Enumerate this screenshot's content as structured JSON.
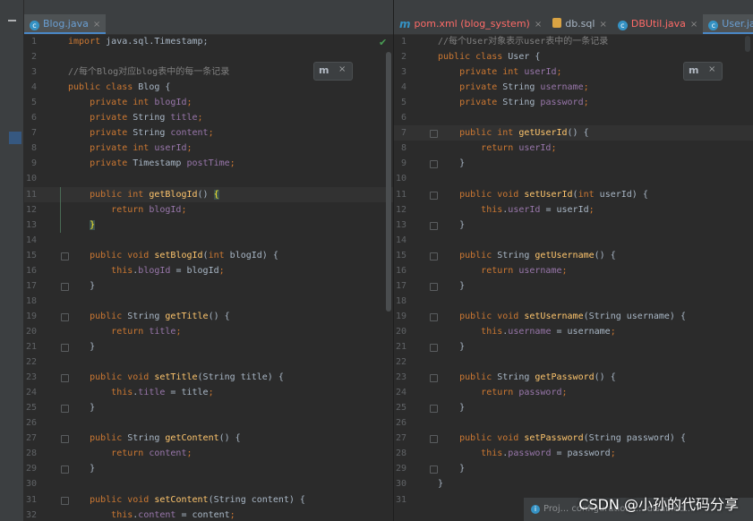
{
  "left_pane": {
    "tabs": [
      {
        "label": "Blog.java",
        "icon": "java-class-icon",
        "style": "blue",
        "active": true
      }
    ],
    "current_line": 11,
    "lines": [
      [
        [
          "java.sql.Timestamp;",
          "p"
        ]
      ],
      [],
      [
        [
          "//每个Blog对应blog表中的每一条记录",
          "cm"
        ]
      ],
      [],
      [
        [
          "    ",
          "p"
        ],
        [
          "private ",
          "kw"
        ],
        [
          "int ",
          "kw"
        ],
        [
          "blogId",
          "fld"
        ],
        [
          ";",
          "kw"
        ]
      ],
      [
        [
          "    ",
          "p"
        ],
        [
          "private ",
          "kw"
        ],
        [
          "String ",
          "p"
        ],
        [
          "title",
          "fld"
        ],
        [
          ";",
          "kw"
        ]
      ],
      [
        [
          "    ",
          "p"
        ],
        [
          "private ",
          "kw"
        ],
        [
          "String ",
          "p"
        ],
        [
          "content",
          "fld"
        ],
        [
          ";",
          "kw"
        ]
      ],
      [
        [
          "    ",
          "p"
        ],
        [
          "private ",
          "kw"
        ],
        [
          "int ",
          "kw"
        ],
        [
          "userId",
          "fld"
        ],
        [
          ";",
          "kw"
        ]
      ],
      [
        [
          "    ",
          "p"
        ],
        [
          "private ",
          "kw"
        ],
        [
          "Timestamp ",
          "p"
        ],
        [
          "postTime",
          "fld"
        ],
        [
          ";",
          "kw"
        ]
      ],
      [],
      [
        [
          "    ",
          "p"
        ],
        [
          "public ",
          "kw"
        ],
        [
          "int ",
          "kw"
        ],
        [
          "getBlogId",
          "fn"
        ],
        [
          "() ",
          "p"
        ],
        [
          "{",
          "brk"
        ]
      ],
      [
        [
          "        ",
          "p"
        ],
        [
          "return ",
          "kw"
        ],
        [
          "blogId",
          "fld"
        ],
        [
          ";",
          "kw"
        ]
      ],
      [
        [
          "    ",
          "p"
        ],
        [
          "}",
          "brk"
        ]
      ],
      [],
      [
        [
          "    ",
          "p"
        ],
        [
          "public ",
          "kw"
        ],
        [
          "void ",
          "kw"
        ],
        [
          "setBlogId",
          "fn"
        ],
        [
          "(",
          "p"
        ],
        [
          "int ",
          "kw"
        ],
        [
          "blogId) {",
          "p"
        ]
      ],
      [
        [
          "        ",
          "p"
        ],
        [
          "this",
          "kw"
        ],
        [
          ".",
          "p"
        ],
        [
          "blogId",
          "fld"
        ],
        [
          " = blogId",
          "p"
        ],
        [
          ";",
          "kw"
        ]
      ],
      [
        [
          "    }",
          "p"
        ]
      ],
      [],
      [
        [
          "    ",
          "p"
        ],
        [
          "public ",
          "kw"
        ],
        [
          "String ",
          "p"
        ],
        [
          "getTitle",
          "fn"
        ],
        [
          "() {",
          "p"
        ]
      ],
      [
        [
          "        ",
          "p"
        ],
        [
          "return ",
          "kw"
        ],
        [
          "title",
          "fld"
        ],
        [
          ";",
          "kw"
        ]
      ],
      [
        [
          "    }",
          "p"
        ]
      ],
      [],
      [
        [
          "    ",
          "p"
        ],
        [
          "public ",
          "kw"
        ],
        [
          "void ",
          "kw"
        ],
        [
          "setTitle",
          "fn"
        ],
        [
          "(String title) {",
          "p"
        ]
      ],
      [
        [
          "        ",
          "p"
        ],
        [
          "this",
          "kw"
        ],
        [
          ".",
          "p"
        ],
        [
          "title",
          "fld"
        ],
        [
          " = title",
          "p"
        ],
        [
          ";",
          "kw"
        ]
      ],
      [
        [
          "    }",
          "p"
        ]
      ],
      [],
      [
        [
          "    ",
          "p"
        ],
        [
          "public ",
          "kw"
        ],
        [
          "String ",
          "p"
        ],
        [
          "getContent",
          "fn"
        ],
        [
          "() {",
          "p"
        ]
      ],
      [
        [
          "        ",
          "p"
        ],
        [
          "return ",
          "kw"
        ],
        [
          "content",
          "fld"
        ],
        [
          ";",
          "kw"
        ]
      ],
      [
        [
          "    }",
          "p"
        ]
      ],
      [],
      [
        [
          "    ",
          "p"
        ],
        [
          "public ",
          "kw"
        ],
        [
          "void ",
          "kw"
        ],
        [
          "setContent",
          "fn"
        ],
        [
          "(String content) {",
          "p"
        ]
      ],
      [
        [
          "        ",
          "p"
        ],
        [
          "this",
          "kw"
        ],
        [
          ".",
          "p"
        ],
        [
          "content",
          "fld"
        ],
        [
          " = content",
          "p"
        ],
        [
          ";",
          "kw"
        ]
      ]
    ],
    "first_line_prefix": "import ",
    "line4_prefix": "public class Blog {",
    "bubble_close": "×"
  },
  "right_pane": {
    "tabs": [
      {
        "label": "pom.xml (blog_system)",
        "icon": "maven-icon",
        "style": "red",
        "active": false
      },
      {
        "label": "db.sql",
        "icon": "sql-file-icon",
        "style": "plain",
        "active": false
      },
      {
        "label": "DBUtil.java",
        "icon": "java-class-icon",
        "style": "red",
        "active": false
      },
      {
        "label": "User.java",
        "icon": "java-class-icon",
        "style": "blue",
        "active": true
      }
    ],
    "current_line": 7,
    "lines": [
      [
        [
          "//每个User对象表示user表中的一条记录",
          "cm"
        ]
      ],
      [
        [
          "public ",
          "kw"
        ],
        [
          "class ",
          "kw"
        ],
        [
          "User {",
          "p"
        ]
      ],
      [
        [
          "    ",
          "p"
        ],
        [
          "private ",
          "kw"
        ],
        [
          "int ",
          "kw"
        ],
        [
          "userId",
          "fld"
        ],
        [
          ";",
          "kw"
        ]
      ],
      [
        [
          "    ",
          "p"
        ],
        [
          "private ",
          "kw"
        ],
        [
          "String ",
          "p"
        ],
        [
          "username",
          "fld"
        ],
        [
          ";",
          "kw"
        ]
      ],
      [
        [
          "    ",
          "p"
        ],
        [
          "private ",
          "kw"
        ],
        [
          "String ",
          "p"
        ],
        [
          "password",
          "fld"
        ],
        [
          ";",
          "kw"
        ]
      ],
      [],
      [
        [
          "    ",
          "p"
        ],
        [
          "public ",
          "kw"
        ],
        [
          "int ",
          "kw"
        ],
        [
          "getUserId",
          "fn"
        ],
        [
          "() {",
          "p"
        ]
      ],
      [
        [
          "        ",
          "p"
        ],
        [
          "return ",
          "kw"
        ],
        [
          "userId",
          "fld"
        ],
        [
          ";",
          "kw"
        ]
      ],
      [
        [
          "    }",
          "p"
        ]
      ],
      [],
      [
        [
          "    ",
          "p"
        ],
        [
          "public ",
          "kw"
        ],
        [
          "void ",
          "kw"
        ],
        [
          "setUserId",
          "fn"
        ],
        [
          "(",
          "p"
        ],
        [
          "int ",
          "kw"
        ],
        [
          "userId) {",
          "p"
        ]
      ],
      [
        [
          "        ",
          "p"
        ],
        [
          "this",
          "kw"
        ],
        [
          ".",
          "p"
        ],
        [
          "userId",
          "fld"
        ],
        [
          " = userId",
          "p"
        ],
        [
          ";",
          "kw"
        ]
      ],
      [
        [
          "    }",
          "p"
        ]
      ],
      [],
      [
        [
          "    ",
          "p"
        ],
        [
          "public ",
          "kw"
        ],
        [
          "String ",
          "p"
        ],
        [
          "getUsername",
          "fn"
        ],
        [
          "() {",
          "p"
        ]
      ],
      [
        [
          "        ",
          "p"
        ],
        [
          "return ",
          "kw"
        ],
        [
          "username",
          "fld"
        ],
        [
          ";",
          "kw"
        ]
      ],
      [
        [
          "    }",
          "p"
        ]
      ],
      [],
      [
        [
          "    ",
          "p"
        ],
        [
          "public ",
          "kw"
        ],
        [
          "void ",
          "kw"
        ],
        [
          "setUsername",
          "fn"
        ],
        [
          "(String username) {",
          "p"
        ]
      ],
      [
        [
          "        ",
          "p"
        ],
        [
          "this",
          "kw"
        ],
        [
          ".",
          "p"
        ],
        [
          "username",
          "fld"
        ],
        [
          " = username",
          "p"
        ],
        [
          ";",
          "kw"
        ]
      ],
      [
        [
          "    }",
          "p"
        ]
      ],
      [],
      [
        [
          "    ",
          "p"
        ],
        [
          "public ",
          "kw"
        ],
        [
          "String ",
          "p"
        ],
        [
          "getPassword",
          "fn"
        ],
        [
          "() {",
          "p"
        ]
      ],
      [
        [
          "        ",
          "p"
        ],
        [
          "return ",
          "kw"
        ],
        [
          "password",
          "fld"
        ],
        [
          ";",
          "kw"
        ]
      ],
      [
        [
          "    }",
          "p"
        ]
      ],
      [],
      [
        [
          "    ",
          "p"
        ],
        [
          "public ",
          "kw"
        ],
        [
          "void ",
          "kw"
        ],
        [
          "setPassword",
          "fn"
        ],
        [
          "(String password) {",
          "p"
        ]
      ],
      [
        [
          "        ",
          "p"
        ],
        [
          "this",
          "kw"
        ],
        [
          ".",
          "p"
        ],
        [
          "password",
          "fld"
        ],
        [
          " = password",
          "p"
        ],
        [
          ";",
          "kw"
        ]
      ],
      [
        [
          "    }",
          "p"
        ]
      ],
      [
        [
          "}",
          "p"
        ]
      ],
      []
    ],
    "bubble_close": "×"
  },
  "watermark": "CSDN @小孙的代码分享",
  "status_text": "Proj... configurations... disabled... ",
  "colors": {
    "keyword": "#cc7832",
    "function": "#ffc66d",
    "field": "#9876aa",
    "comment": "#808080",
    "text": "#a9b7c6",
    "background": "#2b2b2b"
  }
}
